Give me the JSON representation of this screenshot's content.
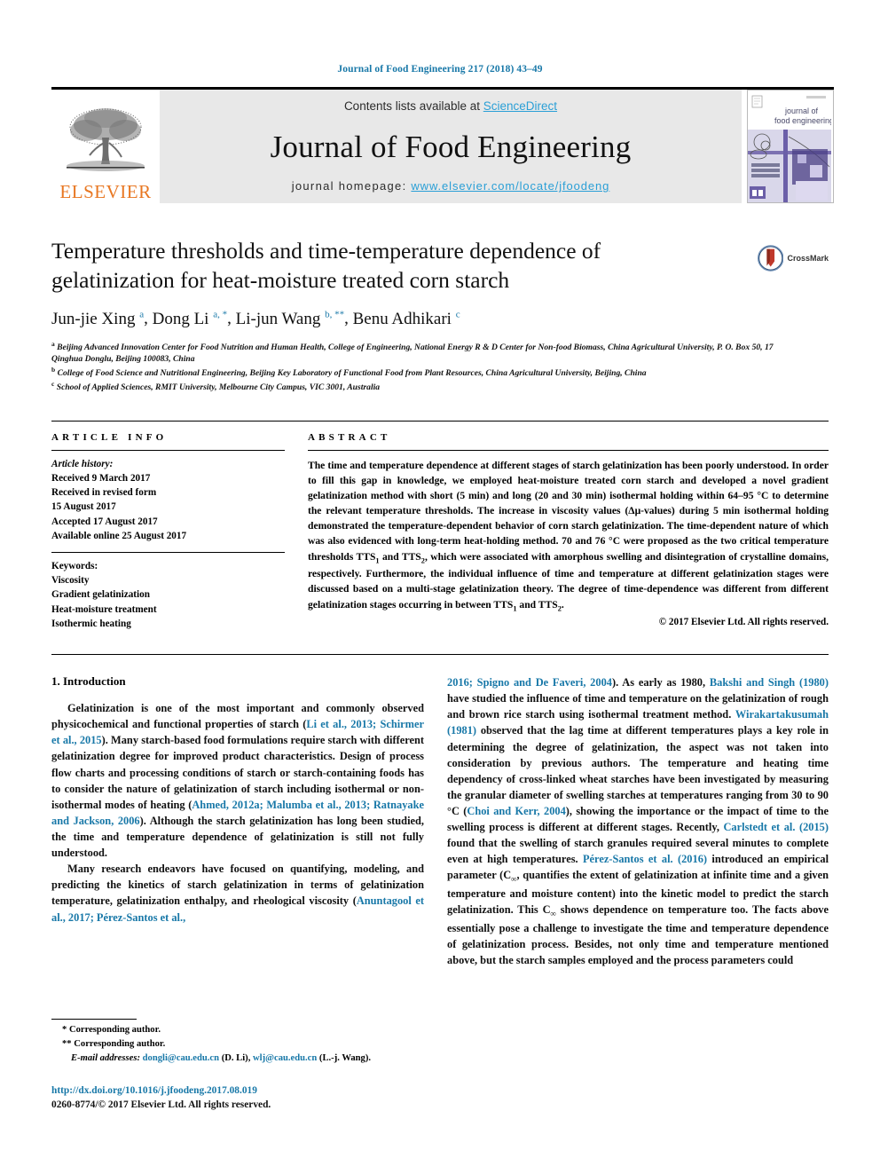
{
  "running_head": "Journal of Food Engineering 217 (2018) 43–49",
  "masthead": {
    "publisher_name": "ELSEVIER",
    "contents_prefix": "Contents lists available at ",
    "contents_link": "ScienceDirect",
    "journal_title": "Journal of Food Engineering",
    "homepage_prefix": "journal homepage: ",
    "homepage_url": "www.elsevier.com/locate/jfoodeng",
    "cover_title_line1": "journal of",
    "cover_title_line2": "food engineering"
  },
  "article": {
    "title": "Temperature thresholds and time-temperature dependence of gelatinization for heat-moisture treated corn starch",
    "crossmark_label": "CrossMark",
    "authors": [
      {
        "name": "Jun-jie Xing",
        "marks": "a"
      },
      {
        "name": "Dong Li",
        "marks": "a, *"
      },
      {
        "name": "Li-jun Wang",
        "marks": "b, **"
      },
      {
        "name": "Benu Adhikari",
        "marks": "c"
      }
    ],
    "affiliations": [
      {
        "mark": "a",
        "text": "Beijing Advanced Innovation Center for Food Nutrition and Human Health, College of Engineering, National Energy R & D Center for Non-food Biomass, China Agricultural University, P. O. Box 50, 17 Qinghua Donglu, Beijing 100083, China"
      },
      {
        "mark": "b",
        "text": "College of Food Science and Nutritional Engineering, Beijing Key Laboratory of Functional Food from Plant Resources, China Agricultural University, Beijing, China"
      },
      {
        "mark": "c",
        "text": "School of Applied Sciences, RMIT University, Melbourne City Campus, VIC 3001, Australia"
      }
    ]
  },
  "article_info": {
    "heading": "ARTICLE INFO",
    "history_label": "Article history:",
    "history": [
      "Received 9 March 2017",
      "Received in revised form",
      "15 August 2017",
      "Accepted 17 August 2017",
      "Available online 25 August 2017"
    ],
    "keywords_label": "Keywords:",
    "keywords": [
      "Viscosity",
      "Gradient gelatinization",
      "Heat-moisture treatment",
      "Isothermic heating"
    ]
  },
  "abstract": {
    "heading": "ABSTRACT",
    "text": "The time and temperature dependence at different stages of starch gelatinization has been poorly understood. In order to fill this gap in knowledge, we employed heat-moisture treated corn starch and developed a novel gradient gelatinization method with short (5 min) and long (20 and 30 min) isothermal holding within 64–95 °C to determine the relevant temperature thresholds. The increase in viscosity values (Δμ-values) during 5 min isothermal holding demonstrated the temperature-dependent behavior of corn starch gelatinization. The time-dependent nature of which was also evidenced with long-term heat-holding method. 70 and 76 °C were proposed as the two critical temperature thresholds TTS1 and TTS2, which were associated with amorphous swelling and disintegration of crystalline domains, respectively. Furthermore, the individual influence of time and temperature at different gelatinization stages were discussed based on a multi-stage gelatinization theory. The degree of time-dependence was different from different gelatinization stages occurring in between TTS1 and TTS2.",
    "copyright": "© 2017 Elsevier Ltd. All rights reserved."
  },
  "body": {
    "section_title": "1. Introduction",
    "left_paragraphs": [
      "Gelatinization is one of the most important and commonly observed physicochemical and functional properties of starch (Li et al., 2013; Schirmer et al., 2015). Many starch-based food formulations require starch with different gelatinization degree for improved product characteristics. Design of process flow charts and processing conditions of starch or starch-containing foods has to consider the nature of gelatinization of starch including isothermal or non-isothermal modes of heating (Ahmed, 2012a; Malumba et al., 2013; Ratnayake and Jackson, 2006). Although the starch gelatinization has long been studied, the time and temperature dependence of gelatinization is still not fully understood.",
      "Many research endeavors have focused on quantifying, modeling, and predicting the kinetics of starch gelatinization in terms of gelatinization temperature, gelatinization enthalpy, and rheological viscosity (Anuntagool et al., 2017; Pérez-Santos et al.,"
    ],
    "right_paragraphs": [
      "2016; Spigno and De Faveri, 2004). As early as 1980, Bakshi and Singh (1980) have studied the influence of time and temperature on the gelatinization of rough and brown rice starch using isothermal treatment method. Wirakartakusumah (1981) observed that the lag time at different temperatures plays a key role in determining the degree of gelatinization, the aspect was not taken into consideration by previous authors. The temperature and heating time dependency of cross-linked wheat starches have been investigated by measuring the granular diameter of swelling starches at temperatures ranging from 30 to 90 °C (Choi and Kerr, 2004), showing the importance or the impact of time to the swelling process is different at different stages. Recently, Carlstedt et al. (2015) found that the swelling of starch granules required several minutes to complete even at high temperatures. Pérez-Santos et al. (2016) introduced an empirical parameter (C∞, quantifies the extent of gelatinization at infinite time and a given temperature and moisture content) into the kinetic model to predict the starch gelatinization. This C∞ shows dependence on temperature too. The facts above essentially pose a challenge to investigate the time and temperature dependence of gelatinization process. Besides, not only time and temperature mentioned above, but the starch samples employed and the process parameters could"
    ]
  },
  "footnotes": {
    "corresponding_1": "* Corresponding author.",
    "corresponding_2": "** Corresponding author.",
    "email_label": "E-mail addresses:",
    "email_1": "dongli@cau.edu.cn",
    "email_1_owner": "(D. Li),",
    "email_2": "wlj@cau.edu.cn",
    "email_2_owner": "(L.-j. Wang).",
    "doi": "http://dx.doi.org/10.1016/j.jfoodeng.2017.08.019",
    "issn": "0260-8774/© 2017 Elsevier Ltd. All rights reserved."
  },
  "colors": {
    "link_blue": "#1878a8",
    "sciencedirect_blue": "#2a9fd6",
    "elsevier_orange": "#E87722",
    "masthead_grey": "#e8e8e8",
    "cover_purple": "#6b5fa8"
  }
}
